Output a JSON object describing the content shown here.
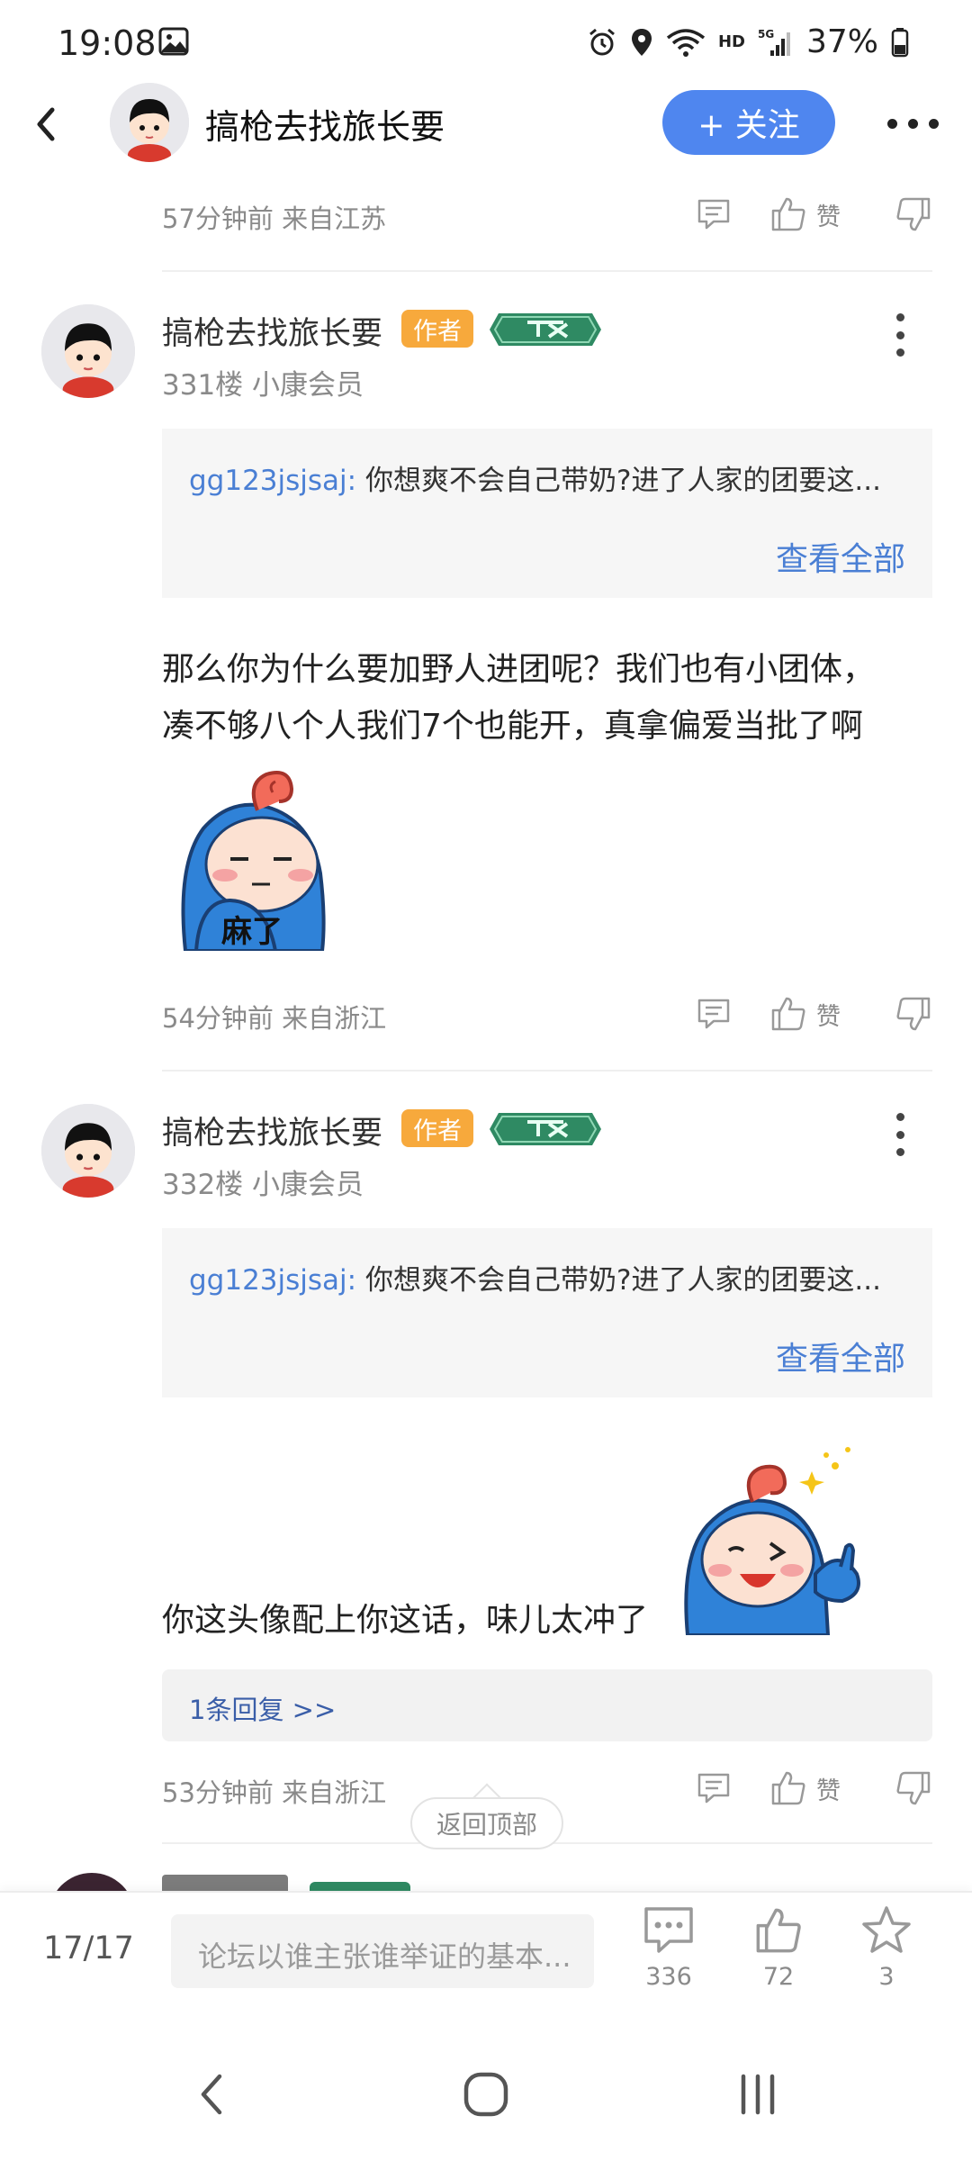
{
  "status_bar": {
    "time": "19:08",
    "hd": "HD",
    "network": "5G",
    "battery": "37%"
  },
  "nav": {
    "title": "搞枪去找旅长要",
    "follow_label": "+ 关注"
  },
  "top_meta": {
    "text": "57分钟前 来自江苏",
    "like_label": "赞"
  },
  "posts": [
    {
      "username": "搞枪去找旅长要",
      "author_badge": "作者",
      "floor": "331楼 小康会员",
      "quote_user": "gg123jsjsaj:",
      "quote_text": " 你想爽不会自己带奶?进了人家的团要这...",
      "quote_more": "查看全部",
      "body_lines": [
        "那么你为什么要加野人进团呢？我们也有小团体，",
        "凑不够八个人我们7个也能开，真拿偏爱当批了啊"
      ],
      "sticker_text": "麻了",
      "meta": "54分钟前 来自浙江",
      "like_label": "赞"
    },
    {
      "username": "搞枪去找旅长要",
      "author_badge": "作者",
      "floor": "332楼 小康会员",
      "quote_user": "gg123jsjsaj:",
      "quote_text": " 你想爽不会自己带奶?进了人家的团要这...",
      "quote_more": "查看全部",
      "body": "你这头像配上你这话，味儿太冲了",
      "replies": "1条回复 >>",
      "meta": "53分钟前 来自浙江",
      "like_label": "赞"
    }
  ],
  "back_to_top": "返回顶部",
  "bottom_bar": {
    "page": "17/17",
    "input_placeholder": "论坛以谁主张谁举证的基本...",
    "comments": "336",
    "likes": "72",
    "favorites": "3"
  },
  "colors": {
    "accent": "#4f86ef",
    "link": "#4a7fd4",
    "author_badge": "#f7a93c",
    "level_badge": "#2f8a63"
  },
  "icons": [
    "back-arrow-icon",
    "more-icon",
    "comment-icon",
    "thumbs-up-icon",
    "thumbs-down-icon",
    "kebab-icon",
    "star-icon"
  ]
}
